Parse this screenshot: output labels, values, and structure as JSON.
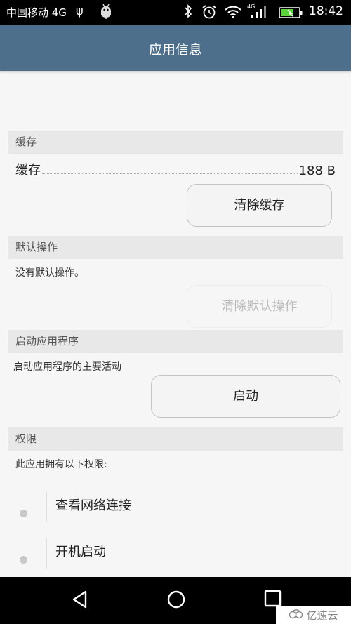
{
  "status_bar": {
    "carrier": "中国移动 4G",
    "network_type": "4G",
    "time": "18:42",
    "icons": [
      "usb-icon",
      "android-debug-icon",
      "bluetooth-icon",
      "alarm-icon",
      "wifi-icon",
      "signal-icon",
      "battery-charging-icon"
    ]
  },
  "app_bar": {
    "title": "应用信息"
  },
  "cache_section": {
    "header": "缓存",
    "row_label": "缓存",
    "row_value": "188 B",
    "clear_button": "清除缓存"
  },
  "default_section": {
    "header": "默认操作",
    "description": "没有默认操作。",
    "clear_button": "清除默认操作"
  },
  "launch_section": {
    "header": "启动应用程序",
    "description": "启动应用程序的主要活动",
    "launch_button": "启动"
  },
  "permissions_section": {
    "header": "权限",
    "description": "此应用拥有以下权限:",
    "items": [
      {
        "label": "查看网络连接"
      },
      {
        "label": "开机启动"
      }
    ]
  },
  "nav_bar": {
    "buttons": [
      "back-icon",
      "home-icon",
      "recents-icon"
    ]
  },
  "watermark": {
    "text": "亿速云"
  }
}
